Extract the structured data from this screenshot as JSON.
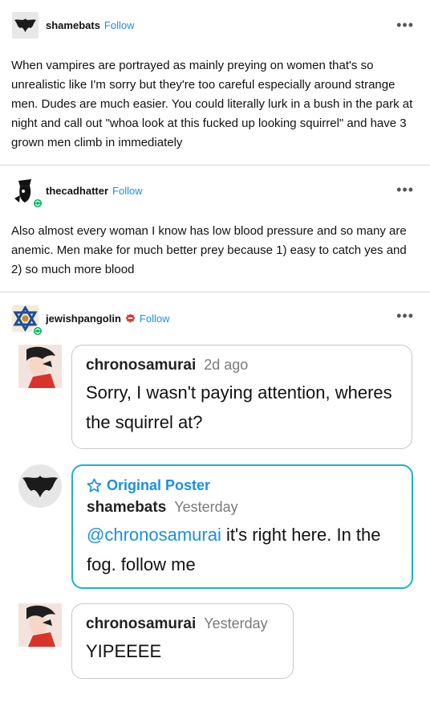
{
  "posts": [
    {
      "username": "shamebats",
      "follow_label": "Follow",
      "more_label": "•••",
      "text": "When vampires are portrayed as mainly preying on women that's so unrealistic like I'm sorry but they're too careful especially around strange men. Dudes are much easier. You could literally lurk in a bush in the park at night and call out \"whoa look at this fucked up looking squirrel\" and have 3 grown men climb in immediately"
    },
    {
      "username": "thecadhatter",
      "follow_label": "Follow",
      "more_label": "•••",
      "text": "Also almost every woman I know has low blood pressure and so many are anemic. Men make for much better prey because 1) easy to catch yes and 2) so much more blood"
    },
    {
      "username": "jewishpangolin",
      "follow_label": "Follow",
      "more_label": "•••"
    }
  ],
  "replies": [
    {
      "username": "chronosamurai",
      "time": "2d ago",
      "text": "Sorry, I wasn't paying attention, wheres the squirrel at?"
    },
    {
      "op_label": "Original Poster",
      "username": "shamebats",
      "time": "Yesterday",
      "mention": "@chronosamurai",
      "text": " it's right here. In the fog. follow me"
    },
    {
      "username": "chronosamurai",
      "time": "Yesterday",
      "text": "YIPEEEE"
    }
  ],
  "colors": {
    "link": "#1a8fe6",
    "op_border": "#1fb0d2",
    "reblog_badge": "#00b85c"
  }
}
